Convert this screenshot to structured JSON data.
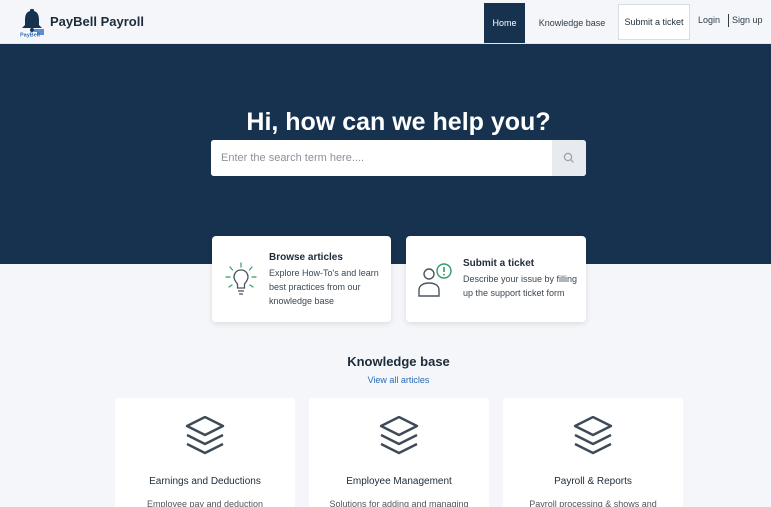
{
  "header": {
    "brand": "PayBell Payroll",
    "nav": {
      "home": "Home",
      "knowledge_base": "Knowledge base",
      "submit_ticket": "Submit a ticket",
      "login": "Login",
      "signup": "Sign up"
    }
  },
  "hero": {
    "title": "Hi, how can we help you?",
    "search_placeholder": "Enter the search term here...."
  },
  "features": [
    {
      "title": "Browse articles",
      "description": "Explore How-To's and learn best practices from our knowledge base",
      "icon": "lightbulb-icon"
    },
    {
      "title": "Submit a ticket",
      "description": "Describe your issue by filling up the support ticket form",
      "icon": "user-support-icon"
    }
  ],
  "knowledge_base": {
    "title": "Knowledge base",
    "view_all": "View all articles",
    "categories": [
      {
        "title": "Earnings and Deductions",
        "description": "Employee pay and deduction",
        "icon": "layers-icon"
      },
      {
        "title": "Employee Management",
        "description": "Solutions for adding and managing",
        "icon": "layers-icon"
      },
      {
        "title": "Payroll & Reports",
        "description": "Payroll processing & shows and",
        "icon": "layers-icon"
      }
    ]
  },
  "colors": {
    "primary": "#16324f",
    "accent_green": "#2c9e6a",
    "link": "#2a6ab5"
  }
}
